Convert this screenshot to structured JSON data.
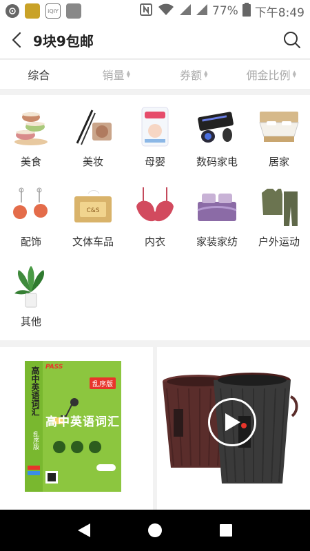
{
  "status_bar": {
    "app_icon_2": "QQ",
    "app_icon_3": "iQIY",
    "battery": "77%",
    "time": "下午8:49"
  },
  "header": {
    "title": "9块9包邮"
  },
  "sort_tabs": [
    {
      "label": "综合",
      "active": true
    },
    {
      "label": "销量",
      "active": false
    },
    {
      "label": "券额",
      "active": false
    },
    {
      "label": "佣金比例",
      "active": false
    }
  ],
  "categories": [
    {
      "label": "美食"
    },
    {
      "label": "美妆"
    },
    {
      "label": "母婴"
    },
    {
      "label": "数码家电"
    },
    {
      "label": "居家"
    },
    {
      "label": "配饰"
    },
    {
      "label": "文体车品"
    },
    {
      "label": "内衣"
    },
    {
      "label": "家装家纺"
    },
    {
      "label": "户外运动"
    },
    {
      "label": "其他"
    }
  ],
  "products": {
    "book": {
      "brand": "PASS",
      "badge": "乱序版",
      "title": "高中英语词汇",
      "side_title": "高中英语词汇",
      "side_sub": "乱序版"
    },
    "bins": {
      "video_label": "play"
    }
  },
  "colors": {
    "accent_red": "#e8352b",
    "book_green": "#8cc63f",
    "bin_brown": "#5a2d2b",
    "bin_dark": "#3a3a3a"
  }
}
